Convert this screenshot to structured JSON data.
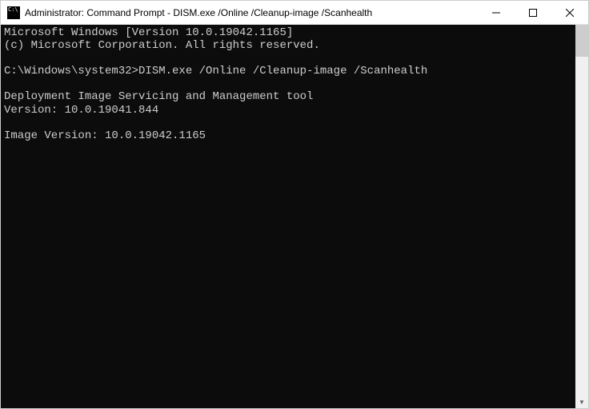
{
  "window": {
    "title": "Administrator: Command Prompt - DISM.exe  /Online /Cleanup-image /Scanhealth"
  },
  "console": {
    "line1": "Microsoft Windows [Version 10.0.19042.1165]",
    "line2": "(c) Microsoft Corporation. All rights reserved.",
    "blank1": "",
    "prompt_line": "C:\\Windows\\system32>DISM.exe /Online /Cleanup-image /Scanhealth",
    "blank2": "",
    "tool_line1": "Deployment Image Servicing and Management tool",
    "tool_line2": "Version: 10.0.19041.844",
    "blank3": "",
    "image_version": "Image Version: 10.0.19042.1165"
  }
}
